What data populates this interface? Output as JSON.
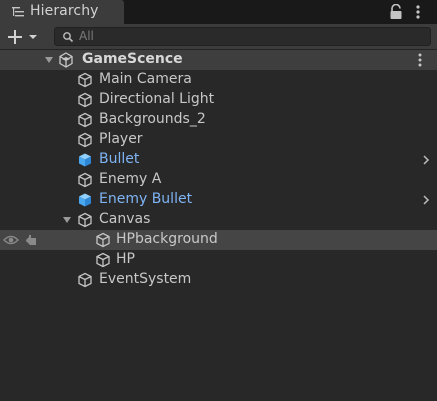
{
  "window": {
    "tab_title": "Hierarchy"
  },
  "toolbar": {
    "search_placeholder": "All"
  },
  "scene": {
    "name": "GameScence"
  },
  "items": [
    {
      "label": "Main Camera",
      "prefab": false
    },
    {
      "label": "Directional Light",
      "prefab": false
    },
    {
      "label": "Backgrounds_2",
      "prefab": false
    },
    {
      "label": "Player",
      "prefab": false
    },
    {
      "label": "Bullet",
      "prefab": true
    },
    {
      "label": "Enemy A",
      "prefab": false
    },
    {
      "label": "Enemy Bullet",
      "prefab": true
    },
    {
      "label": "Canvas",
      "prefab": false,
      "expanded": true
    },
    {
      "label": "HPbackground",
      "prefab": false
    },
    {
      "label": "HP",
      "prefab": false
    },
    {
      "label": "EventSystem",
      "prefab": false
    }
  ],
  "colors": {
    "prefab_text": "#7fb4f5",
    "panel_bg": "#282828",
    "scene_row_bg": "#3e3e3e"
  }
}
